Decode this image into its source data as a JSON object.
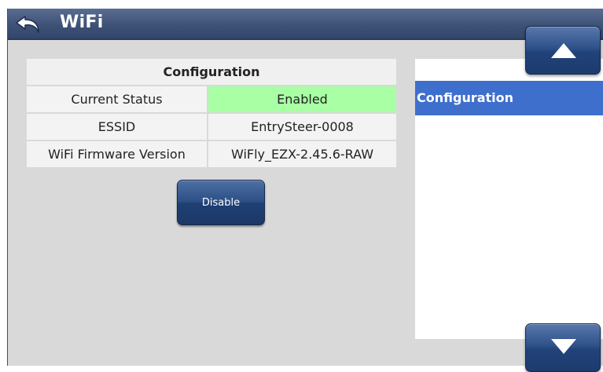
{
  "window": {
    "title": "WiFi",
    "back_icon": "back-arrow-icon"
  },
  "table": {
    "header": "Configuration",
    "rows": [
      {
        "label": "Current Status",
        "value": "Enabled"
      },
      {
        "label": "ESSID",
        "value": "EntrySteer-0008"
      },
      {
        "label": "WiFi Firmware Version",
        "value": "WiFly_EZX-2.45.6-RAW"
      }
    ]
  },
  "actions": {
    "disable_label": "Disable"
  },
  "side_list": {
    "items": [
      {
        "label": "Configuration",
        "selected": true
      }
    ]
  },
  "scroll": {
    "up_icon": "arrow-up-icon",
    "down_icon": "arrow-down-icon"
  },
  "colors": {
    "titlebar": "#3e5177",
    "status_enabled": "#a8ffa4",
    "selection": "#3f6fcd",
    "button": "#2c4f85",
    "background": "#d9d9d9"
  }
}
